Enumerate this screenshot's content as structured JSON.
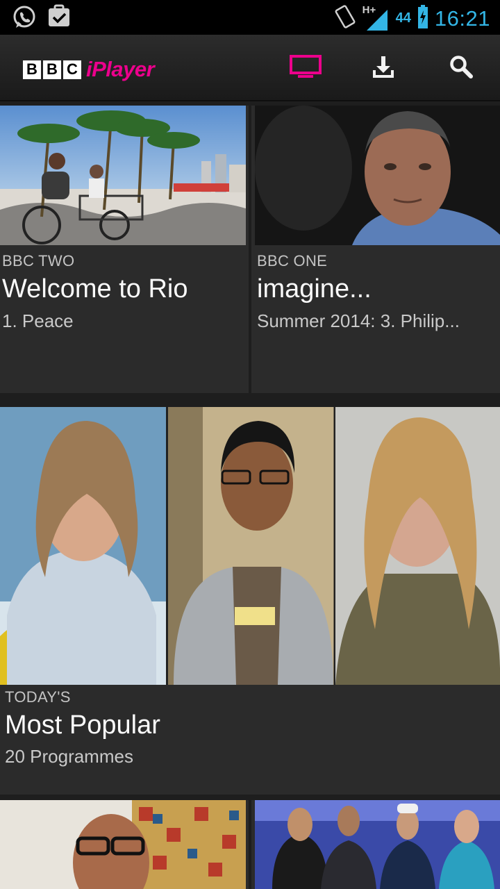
{
  "status_bar": {
    "time": "16:21",
    "network_type": "H+",
    "signal_label": "44",
    "icons": [
      "whatsapp-icon",
      "task-done-icon",
      "vibrate-icon",
      "signal-icon",
      "battery-icon"
    ]
  },
  "app_bar": {
    "logo_bbc": [
      "B",
      "B",
      "C"
    ],
    "logo_iplayer": "iPlayer",
    "icons": [
      "tv-icon",
      "download-icon",
      "search-icon"
    ],
    "accent_color": "#ec008c"
  },
  "tiles": [
    {
      "channel": "BBC TWO",
      "title": "Welcome to Rio",
      "subtitle": "1. Peace"
    },
    {
      "channel": "BBC ONE",
      "title": "imagine...",
      "subtitle": "Summer 2014: 3. Philip..."
    }
  ],
  "collection": {
    "label": "TODAY'S",
    "title": "Most Popular",
    "subtitle": "20 Programmes"
  }
}
